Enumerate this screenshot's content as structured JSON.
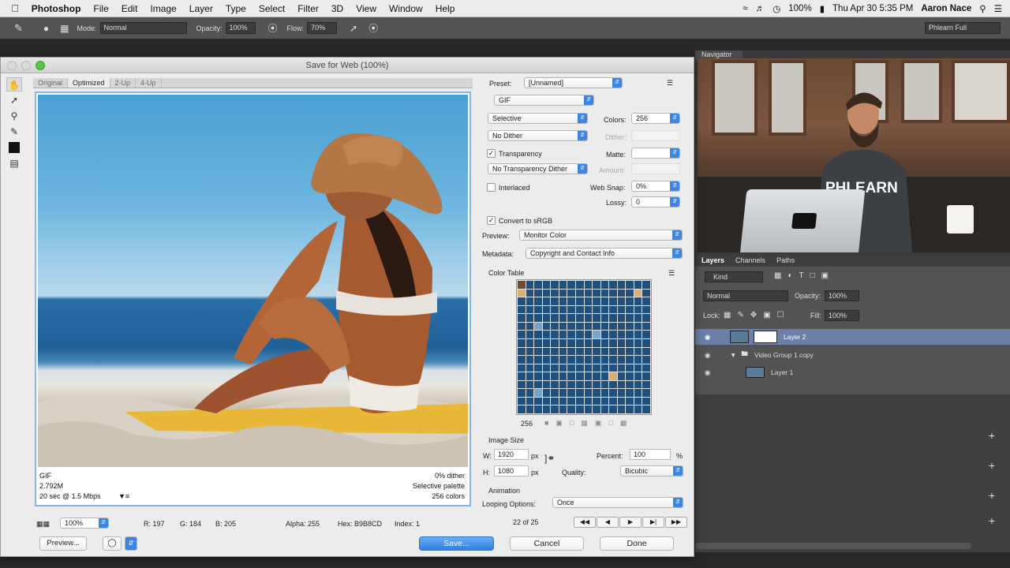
{
  "menubar": {
    "app": "Photoshop",
    "items": [
      "File",
      "Edit",
      "Image",
      "Layer",
      "Type",
      "Select",
      "Filter",
      "3D",
      "View",
      "Window",
      "Help"
    ],
    "battery": "100%",
    "datetime": "Thu Apr 30  5:35 PM",
    "user": "Aaron Nace"
  },
  "optbar": {
    "mode_label": "Mode:",
    "mode_value": "Normal",
    "opacity_label": "Opacity:",
    "opacity_value": "100%",
    "flow_label": "Flow:",
    "flow_value": "70%",
    "workspace": "Phlearn Full"
  },
  "navigator": {
    "tab": "Navigator",
    "brand_text": "PHLEARN"
  },
  "layers": {
    "tabs": [
      "Layers",
      "Channels",
      "Paths"
    ],
    "kind": "Kind",
    "blend": "Normal",
    "opacity_label": "Opacity:",
    "opacity_value": "100%",
    "lock_label": "Lock:",
    "fill_label": "Fill:",
    "fill_value": "100%",
    "rows": [
      {
        "name": "Layer 2"
      },
      {
        "name": "Video Group 1 copy"
      },
      {
        "name": "Layer 1"
      }
    ]
  },
  "dialog": {
    "title": "Save for Web (100%)",
    "view_tabs": [
      "Original",
      "Optimized",
      "2-Up",
      "4-Up"
    ],
    "image_info": {
      "format": "GIF",
      "size": "2.792M",
      "time": "20 sec @ 1.5 Mbps",
      "dither": "0% dither",
      "palette": "Selective palette",
      "colors": "256 colors"
    },
    "preset_label": "Preset:",
    "preset_value": "[Unnamed]",
    "format_value": "GIF",
    "reduction_value": "Selective",
    "dither_algo": "No Dither",
    "colors_label": "Colors:",
    "colors_value": "256",
    "dither_label": "Dither:",
    "transparency_label": "Transparency",
    "matte_label": "Matte:",
    "trans_dither": "No Transparency Dither",
    "amount_label": "Amount:",
    "interlaced_label": "Interlaced",
    "websnap_label": "Web Snap:",
    "websnap_value": "0%",
    "lossy_label": "Lossy:",
    "lossy_value": "0",
    "srgb_label": "Convert to sRGB",
    "preview_label": "Preview:",
    "preview_value": "Monitor Color",
    "metadata_label": "Metadata:",
    "metadata_value": "Copyright and Contact Info",
    "color_table_label": "Color Table",
    "color_count": "256",
    "image_size_label": "Image Size",
    "w_label": "W:",
    "w_value": "1920",
    "h_label": "H:",
    "h_value": "1080",
    "px": "px",
    "percent_label": "Percent:",
    "percent_value": "100",
    "percent_sign": "%",
    "quality_label": "Quality:",
    "quality_value": "Bicubic",
    "animation_label": "Animation",
    "looping_label": "Looping Options:",
    "looping_value": "Once",
    "frame_counter": "22 of 25",
    "status": {
      "zoom": "100%",
      "r": "R: 197",
      "g": "G: 184",
      "b": "B: 205",
      "alpha": "Alpha: 255",
      "hex": "Hex: B9B8CD",
      "index": "Index: 1"
    },
    "buttons": {
      "preview": "Preview...",
      "save": "Save...",
      "cancel": "Cancel",
      "done": "Done"
    }
  },
  "colors": {
    "accent": "#3b86e0",
    "palette": [
      "#1f4f7a",
      "#2e6a9e",
      "#c9a36a",
      "#e7d9b8",
      "#6b4b32",
      "#a9c3d8",
      "#f0e6d0",
      "#3c3a36",
      "#d6b074",
      "#7aa3c8",
      "#f3c23a",
      "#1c2c40",
      "#8a6a48",
      "#cfd8de",
      "#4c86b6",
      "#e9e2d5"
    ]
  }
}
